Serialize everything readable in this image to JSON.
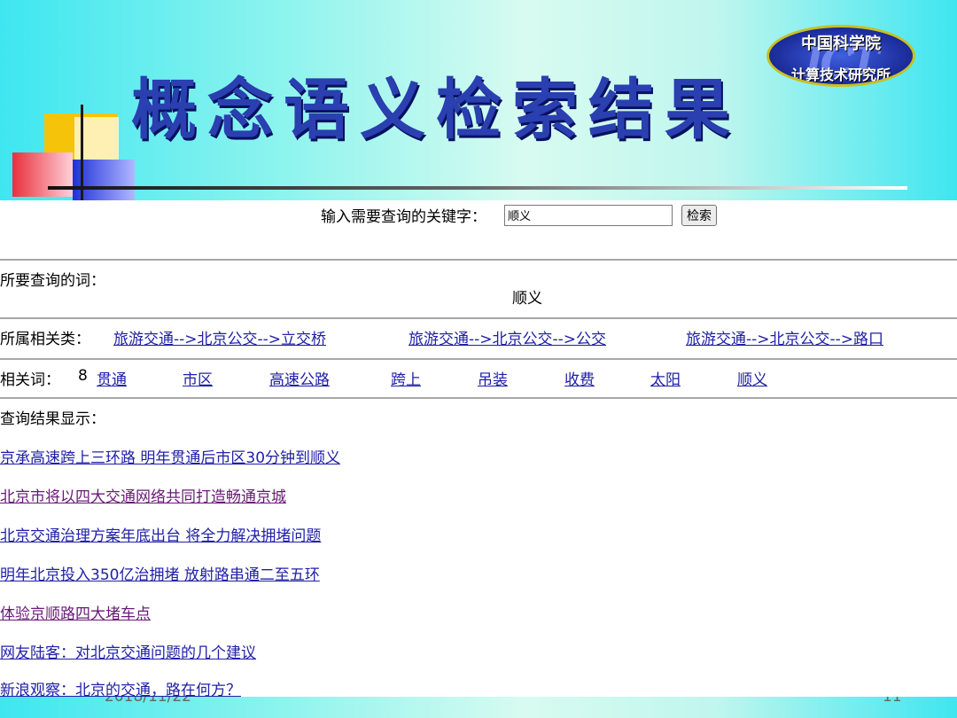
{
  "slide": {
    "title": "概念语义检索结果",
    "logo_top": "中国科学院",
    "logo_bottom": "计算技术研究所",
    "logo_emblem": "ICT",
    "date": "2018/11/22",
    "page_number": "11"
  },
  "search": {
    "label": "输入需要查询的关键字：",
    "value": "顺义",
    "button": "检索"
  },
  "query": {
    "label": "所要查询的词：",
    "word": "顺义"
  },
  "categories": {
    "label": "所属相关类：",
    "items": [
      "旅游交通-->北京公交-->立交桥",
      "旅游交通-->北京公交-->公交",
      "旅游交通-->北京公交-->路口"
    ]
  },
  "related": {
    "label": "相关词：",
    "count": "8",
    "words": [
      "贯通",
      "市区",
      "高速公路",
      "跨上",
      "吊装",
      "收费",
      "太阳",
      "顺义"
    ]
  },
  "results": {
    "label": "查询结果显示：",
    "items": [
      "京承高速跨上三环路 明年贯通后市区30分钟到顺义",
      "北京市将以四大交通网络共同打造畅通京城",
      "北京交通治理方案年底出台 将全力解决拥堵问题",
      "明年北京投入350亿治拥堵 放射路串通二至五环",
      "体验京顺路四大堵车点",
      "网友陆客：对北京交通问题的几个建议",
      "新浪观察：北京的交通，路在何方？"
    ]
  },
  "colors": {
    "title": "#2a3fb0",
    "link": "#2020a8",
    "visited_link": "#6a1a78",
    "slide_bg": "#3ee6f0"
  }
}
